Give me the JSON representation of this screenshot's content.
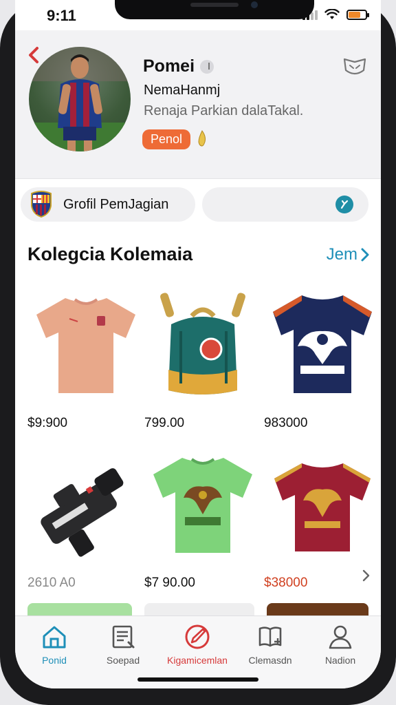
{
  "status_bar": {
    "time": "9:11"
  },
  "profile": {
    "name": "Pomei",
    "handle": "NemaHanmj",
    "bio": "Renaja Parkian dalaTakal.",
    "badge": "Penol"
  },
  "filters": {
    "club_chip_label": "Grofil PemJagian"
  },
  "collection": {
    "title": "Kolegcia Kolemaia",
    "see_all": "Jem",
    "items": [
      {
        "name": "pink-jersey",
        "price": "$9:900"
      },
      {
        "name": "backpack",
        "price": "799.00"
      },
      {
        "name": "navy-jersey",
        "price": "983000"
      },
      {
        "name": "camera",
        "price": "2610 A0"
      },
      {
        "name": "green-jersey",
        "price": "$7 90.00"
      },
      {
        "name": "maroon-jersey",
        "price": "$38000"
      }
    ]
  },
  "tabbar": {
    "tabs": [
      {
        "label": "Ponid",
        "icon": "home-icon",
        "active": true
      },
      {
        "label": "Soepad",
        "icon": "document-icon",
        "active": false
      },
      {
        "label": "Kigamicemlan",
        "icon": "pen-circle-icon",
        "active": false
      },
      {
        "label": "Clemasdn",
        "icon": "book-icon",
        "active": false
      },
      {
        "label": "Nadion",
        "icon": "person-icon",
        "active": false
      }
    ]
  },
  "colors": {
    "accent": "#1e8fb8",
    "badge": "#ee6b36",
    "active_tab": "#1e8fb8",
    "center_tab": "#d63a3a"
  }
}
